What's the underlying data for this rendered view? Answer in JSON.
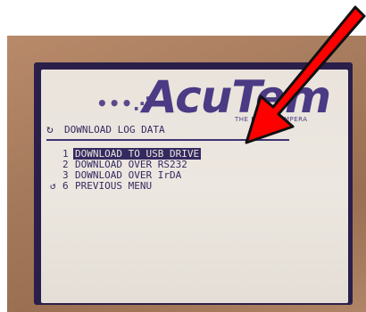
{
  "brand": {
    "name": "AcuTem",
    "tagline": "THE RIGHT TEMPERA"
  },
  "screen": {
    "title": "DOWNLOAD LOG DATA",
    "menu": [
      {
        "number": "1",
        "label": "DOWNLOAD TO USB DRIVE",
        "selected": true
      },
      {
        "number": "2",
        "label": "DOWNLOAD OVER RS232",
        "selected": false
      },
      {
        "number": "3",
        "label": "DOWNLOAD OVER IrDA",
        "selected": false
      },
      {
        "number": "6",
        "label": "PREVIOUS MENU",
        "selected": false
      }
    ]
  },
  "icons": {
    "title_icon": "refresh-icon",
    "back_icon": "back-arrow-icon",
    "annotation": "red-arrow-icon"
  },
  "colors": {
    "lcd_text": "#352a60",
    "lcd_background": "#ece7e0",
    "annotation_arrow": "#ff0000"
  }
}
